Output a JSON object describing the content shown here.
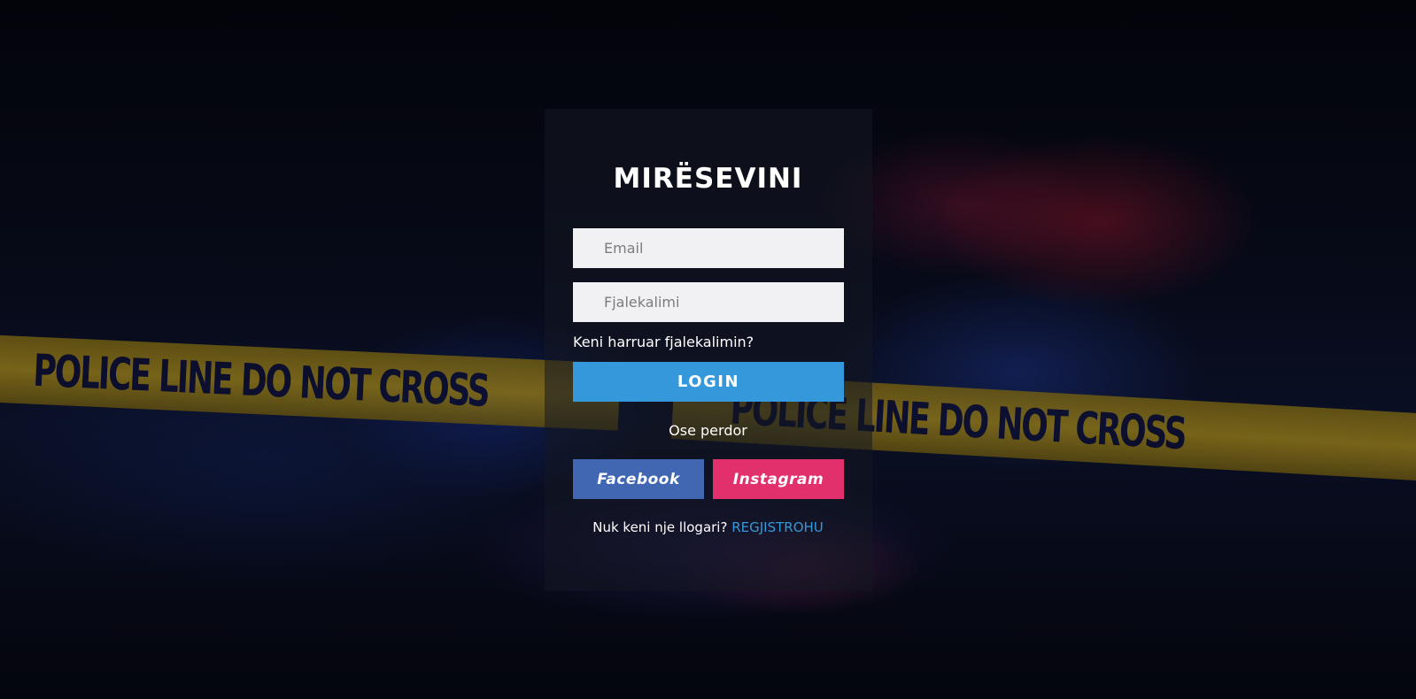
{
  "background": {
    "tape_text_left": "POLICE LINE DO NOT CROSS",
    "tape_text_right": "POLICE LINE DO NOT CROSS"
  },
  "login": {
    "title": "MIRËSEVINI",
    "email_placeholder": "Email",
    "password_placeholder": "Fjalekalimi",
    "forgot_link": "Keni harruar fjalekalimin?",
    "login_button": "LOGIN",
    "or_text": "Ose perdor",
    "facebook_button": "Facebook",
    "instagram_button": "Instagram",
    "no_account_text": "Nuk keni nje llogari?",
    "register_link": "REGJISTROHU"
  },
  "colors": {
    "login_button": "#3498db",
    "facebook": "#4267b2",
    "instagram": "#e1306c",
    "link": "#3498db"
  }
}
